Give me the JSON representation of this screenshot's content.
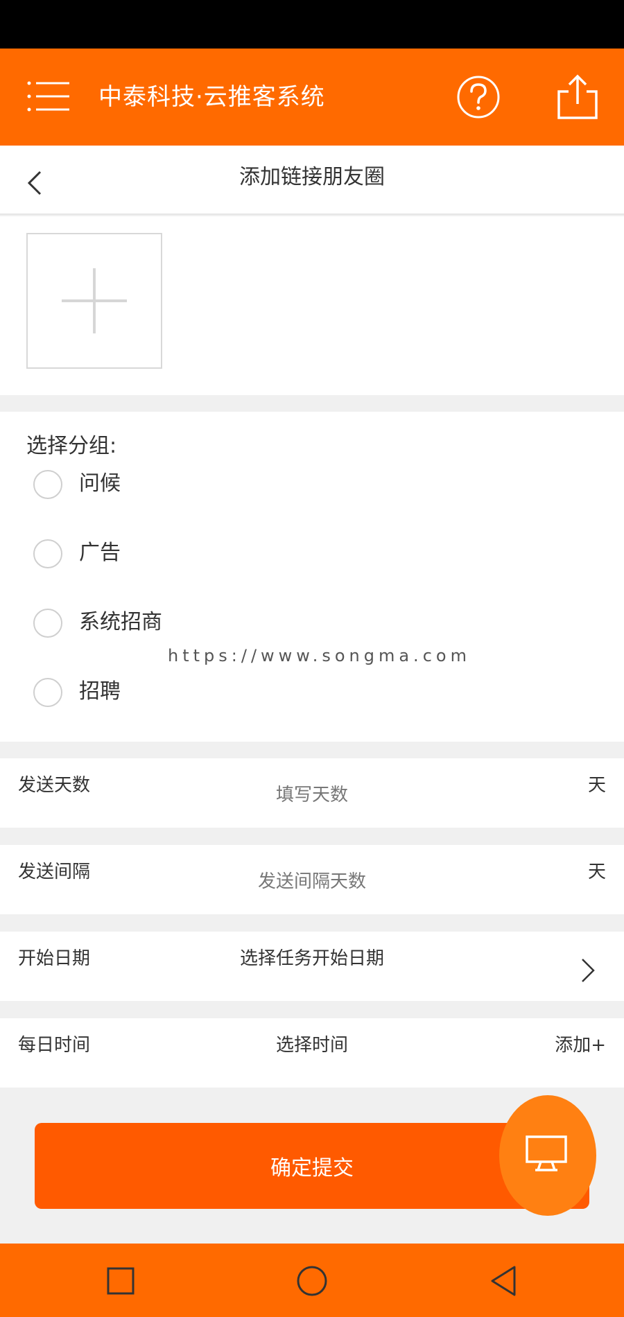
{
  "header": {
    "title": "中泰科技·云推客系统",
    "menu_icon": "menu-icon",
    "help_icon": "help-icon",
    "share_icon": "share-icon"
  },
  "nav": {
    "page_title": "添加链接朋友圈",
    "back_icon": "back-icon"
  },
  "upload": {
    "add_icon": "plus-icon"
  },
  "group": {
    "label": "选择分组:",
    "options": [
      "问候",
      "广告",
      "系统招商",
      "招聘"
    ]
  },
  "watermark": "https://www.songma.com",
  "form": {
    "send_days": {
      "label": "发送天数",
      "placeholder": "填写天数",
      "unit": "天"
    },
    "send_interval": {
      "label": "发送间隔",
      "placeholder": "发送间隔天数",
      "unit": "天"
    },
    "start_date": {
      "label": "开始日期",
      "value": "选择任务开始日期"
    },
    "daily_time": {
      "label": "每日时间",
      "value": "选择时间",
      "add_label": "添加+"
    }
  },
  "submit_label": "确定提交",
  "colors": {
    "accent": "#ff6a00",
    "submit": "#ff5a00",
    "fab": "#ff8012"
  },
  "system_nav": [
    "recent-apps-icon",
    "home-icon",
    "back-nav-icon"
  ]
}
